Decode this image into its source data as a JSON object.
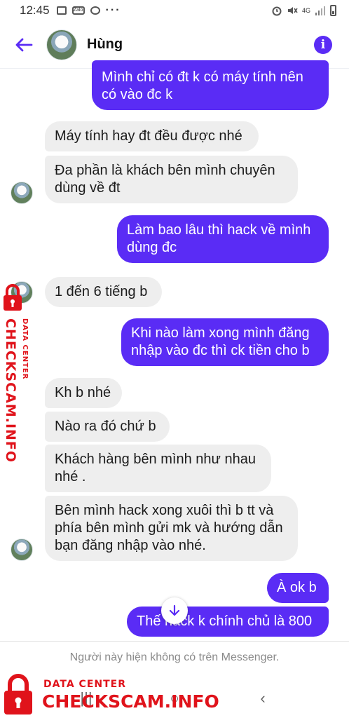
{
  "status_bar": {
    "time": "12:45",
    "app_icons": [
      "image-icon",
      "zalo-icon",
      "chrome-icon"
    ],
    "zalo_label": "Zalo",
    "more": "···",
    "network": "4G"
  },
  "header": {
    "contact_name": "Hùng"
  },
  "messages": [
    {
      "dir": "out",
      "text": "Mình chỉ có đt k có máy tính nên có vào đc k"
    },
    {
      "dir": "in",
      "text": "Máy tính hay đt đều được nhé"
    },
    {
      "dir": "in",
      "text": "Đa phần là khách bên mình chuyên dùng về đt"
    },
    {
      "dir": "out",
      "text": "Làm bao lâu thì hack về mình dùng đc"
    },
    {
      "dir": "in",
      "text": "1 đến 6 tiếng b"
    },
    {
      "dir": "out",
      "text": "Khi nào làm xong mình đăng nhập vào đc thì ck tiền cho b"
    },
    {
      "dir": "in",
      "text": "Kh b nhé"
    },
    {
      "dir": "in",
      "text": "Nào ra đó chứ b"
    },
    {
      "dir": "in",
      "text": "Khách hàng bên mình như nhau nhé ."
    },
    {
      "dir": "in",
      "text": "Bên mình hack xong xuôi thì b tt và phía bên mình gửi mk và hướng dẫn bạn đăng nhập vào nhé."
    },
    {
      "dir": "out",
      "text": "À ok b"
    },
    {
      "dir": "out",
      "text": "Thế hack k chính chủ là 800"
    }
  ],
  "footer": {
    "note": "Người này hiện không có trên Messenger."
  },
  "nav": {
    "recents": "|||",
    "home": "○",
    "back": "‹"
  },
  "watermark": {
    "small": "DATA CENTER",
    "big": "CHECKSCAM.INFO"
  },
  "colors": {
    "accent": "#5a2cf5",
    "incoming_bubble": "#eeeeee",
    "watermark": "#e0131b"
  }
}
